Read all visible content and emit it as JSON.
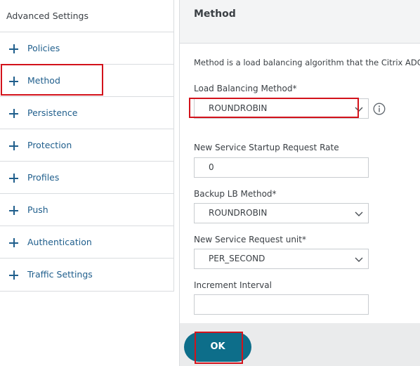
{
  "sidebar": {
    "title": "Advanced Settings",
    "items": [
      {
        "label": "Policies"
      },
      {
        "label": "Method"
      },
      {
        "label": "Persistence"
      },
      {
        "label": "Protection"
      },
      {
        "label": "Profiles"
      },
      {
        "label": "Push"
      },
      {
        "label": "Authentication"
      },
      {
        "label": "Traffic Settings"
      }
    ],
    "highlighted_item": "Method"
  },
  "panel": {
    "title": "Method",
    "description": "Method is a load balancing algorithm that the Citrix ADC u",
    "fields": {
      "lb_method": {
        "label": "Load Balancing Method*",
        "value": "ROUNDROBIN"
      },
      "startup_rate": {
        "label": "New Service Startup Request Rate",
        "value": "0"
      },
      "backup_lb_method": {
        "label": "Backup LB Method*",
        "value": "ROUNDROBIN"
      },
      "request_unit": {
        "label": "New Service Request unit*",
        "value": "PER_SECOND"
      },
      "increment_interval": {
        "label": "Increment Interval",
        "value": ""
      }
    },
    "ok_label": "OK"
  },
  "icons": {
    "plus": "plus-icon",
    "chevron": "chevron-down-icon",
    "info": "info-icon"
  },
  "colors": {
    "link_blue": "#1f5e8c",
    "ok_button": "#0d6e8a",
    "highlight_red": "#d3121b",
    "panel_bg": "#f3f4f5"
  }
}
